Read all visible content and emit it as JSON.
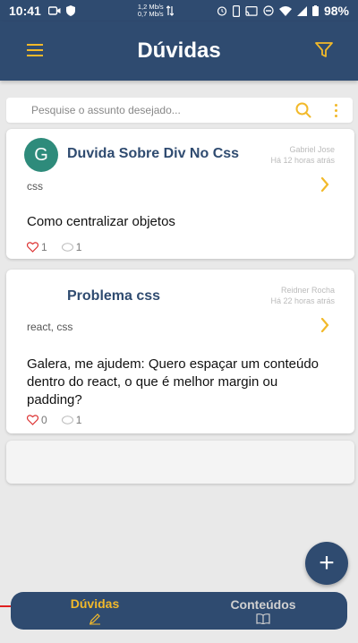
{
  "status": {
    "time": "10:41",
    "net_up": "1,2 Mb/s",
    "net_down": "0,7 Mb/s",
    "battery": "98%"
  },
  "appbar": {
    "title": "Dúvidas"
  },
  "search": {
    "placeholder": "Pesquise o assunto desejado..."
  },
  "questions": [
    {
      "avatar_letter": "G",
      "title": "Duvida Sobre Div No Css",
      "author": "Gabriel Jose",
      "time": "Há 12 horas atrás",
      "tags": "css",
      "body": "Como centralizar objetos",
      "likes": "1",
      "comments": "1"
    },
    {
      "avatar_letter": "",
      "title": "Problema css",
      "author": "Reidner Rocha",
      "time": "Há 22 horas atrás",
      "tags": "react, css",
      "body": "Galera, me ajudem: Quero espaçar um conteúdo dentro do react, o que é melhor margin ou padding?",
      "likes": "0",
      "comments": "1"
    }
  ],
  "fab": {
    "label": "+"
  },
  "nav": {
    "items": [
      {
        "label": "Dúvidas",
        "icon": "pencil-icon",
        "active": true
      },
      {
        "label": "Conteúdos",
        "icon": "book-icon",
        "active": false
      }
    ]
  },
  "colors": {
    "primary": "#2f4b70",
    "accent": "#f2b92a",
    "avatar": "#2e8b7b"
  }
}
